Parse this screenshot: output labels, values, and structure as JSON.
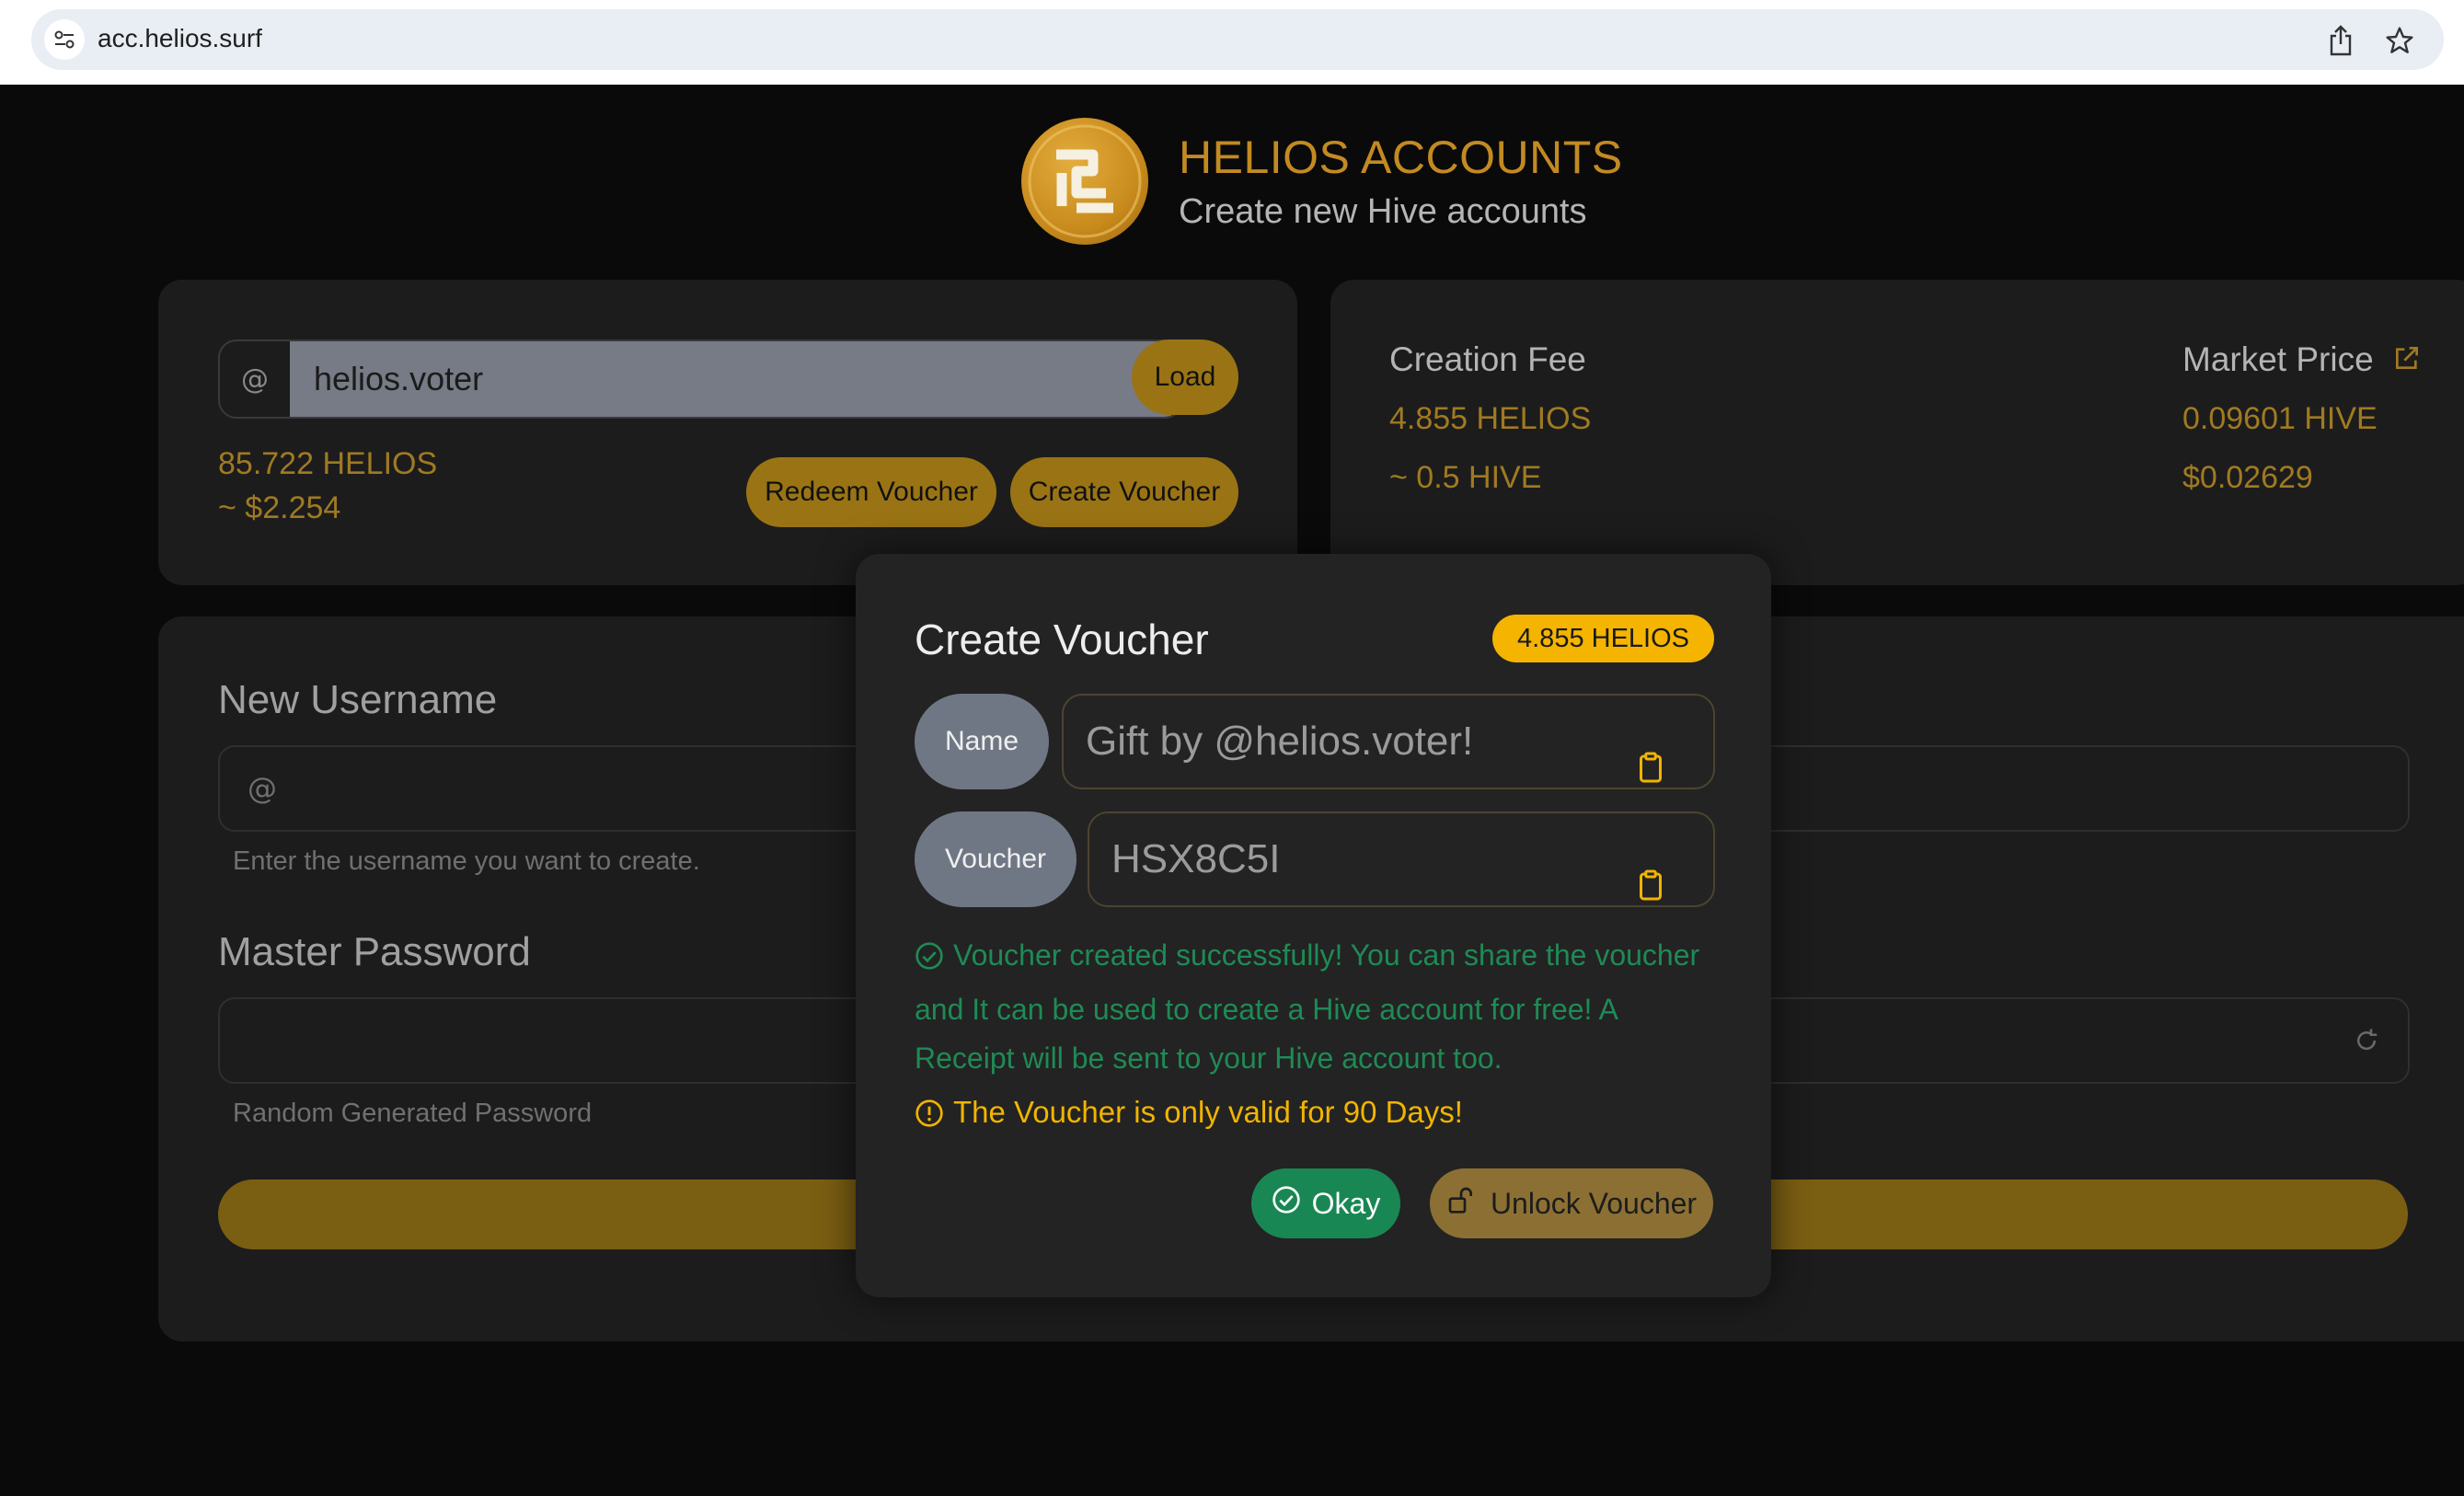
{
  "browser": {
    "url": "acc.helios.surf",
    "icons": [
      "site-info-icon",
      "share-icon",
      "bookmark-star-icon"
    ]
  },
  "header": {
    "title": "HELIOS ACCOUNTS",
    "subtitle": "Create new Hive accounts",
    "logo_icon": "helios-logo-icon"
  },
  "account": {
    "prefix": "@",
    "username": "helios.voter",
    "load_label": "Load",
    "balance_helios": "85.722 HELIOS",
    "balance_usd": "~ $2.254",
    "redeem_label": "Redeem Voucher",
    "create_label": "Create Voucher"
  },
  "fees": {
    "creation_label": "Creation Fee",
    "creation_helios": "4.855 HELIOS",
    "creation_hive": "~ 0.5 HIVE",
    "market_label": "Market Price",
    "market_hive": "0.09601 HIVE",
    "market_usd": "$0.02629"
  },
  "form": {
    "username_label": "New Username",
    "username_prefix": "@",
    "username_hint": "Enter the username you want to create.",
    "password_label": "Master Password",
    "password_hint": "Random Generated Password"
  },
  "modal": {
    "title": "Create Voucher",
    "fee_badge": "4.855 HELIOS",
    "name_pill": "Name",
    "name_value": "Gift by @helios.voter!",
    "voucher_pill": "Voucher",
    "voucher_value": "HSX8C5I",
    "success_message": "Voucher created successfully! You can share the voucher and It can be used to create a Hive account for free! A Receipt will be sent to your Hive account too.",
    "warning_message": "The Voucher is only valid for 90 Days!",
    "okay_label": "Okay",
    "unlock_label": "Unlock Voucher"
  },
  "colors": {
    "accent_gold": "#c38a22",
    "badge_yellow": "#f4b400",
    "success_green": "#198754"
  }
}
